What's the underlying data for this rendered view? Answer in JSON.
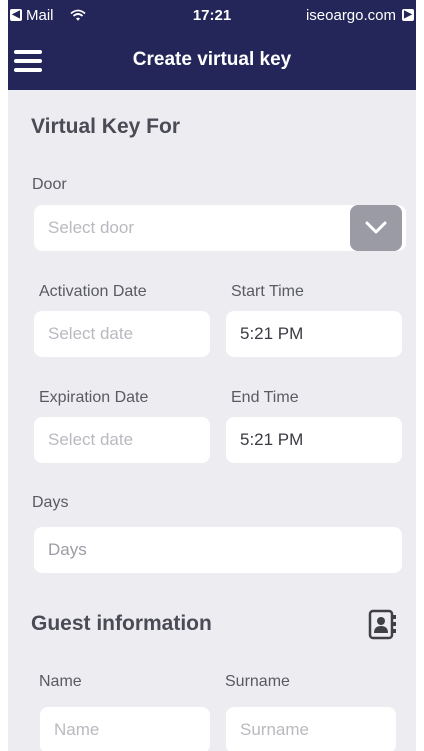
{
  "status_bar": {
    "back_app": "Mail",
    "time": "17:21",
    "site": "iseoargo.com"
  },
  "nav": {
    "title": "Create virtual key"
  },
  "virtual_key": {
    "title": "Virtual Key For",
    "door_label": "Door",
    "door_placeholder": "Select door",
    "activation_label": "Activation Date",
    "activation_placeholder": "Select date",
    "start_time_label": "Start Time",
    "start_time_value": "5:21 PM",
    "expiration_label": "Expiration Date",
    "expiration_placeholder": "Select date",
    "end_time_label": "End Time",
    "end_time_value": "5:21 PM",
    "days_label": "Days",
    "days_placeholder": "Days"
  },
  "guest": {
    "title": "Guest information",
    "name_label": "Name",
    "name_placeholder": "Name",
    "surname_label": "Surname",
    "surname_placeholder": "Surname"
  },
  "icons": {
    "menu": "hamburger-menu-icon",
    "dropdown": "chevron-down-icon",
    "contacts": "address-book-icon",
    "wifi": "wifi-icon"
  },
  "colors": {
    "header": "#24265a",
    "background": "#ececf1",
    "field": "#ffffff",
    "dropdown_button": "#9b9ba5"
  }
}
